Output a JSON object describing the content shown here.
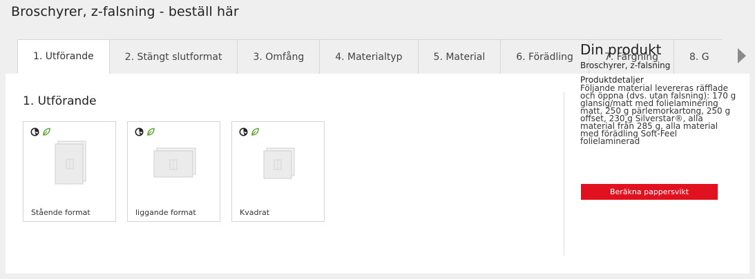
{
  "page": {
    "title": "Broschyrer, z-falsning - beställ här"
  },
  "tabs": [
    {
      "label": "1. Utförande",
      "active": true
    },
    {
      "label": "2. Stängt slutformat"
    },
    {
      "label": "3. Omfång"
    },
    {
      "label": "4. Materialtyp"
    },
    {
      "label": "5. Material"
    },
    {
      "label": "6. Förädling"
    },
    {
      "label": "7. Färgning"
    },
    {
      "label": "8. G"
    }
  ],
  "section": {
    "title": "1. Utförande",
    "options": [
      {
        "label": "Stående format",
        "icons": [
          "climate-neutral-icon",
          "eco-leaf-icon"
        ]
      },
      {
        "label": "liggande format",
        "icons": [
          "climate-neutral-icon",
          "eco-leaf-icon"
        ]
      },
      {
        "label": "Kvadrat",
        "icons": [
          "climate-neutral-icon",
          "eco-leaf-icon"
        ]
      }
    ]
  },
  "product": {
    "heading": "Din produkt",
    "name": "Broschyrer, z-falsning",
    "details_heading": "Produktdetaljer",
    "details_text": "Följande material levereras räfflade och öppna (dvs. utan falsning): 170 g glansig/matt med folielaminering matt, 250 g pärlemorkartong, 250 g offset, 230 g Silverstar®, alla material från 285 g, alla material med förädling Soft-Feel folielaminerad"
  },
  "actions": {
    "calc_label": "Beräkna pappersvikt"
  },
  "colors": {
    "accent": "#e2111f",
    "leaf": "#5aa832",
    "background": "#efefef"
  }
}
